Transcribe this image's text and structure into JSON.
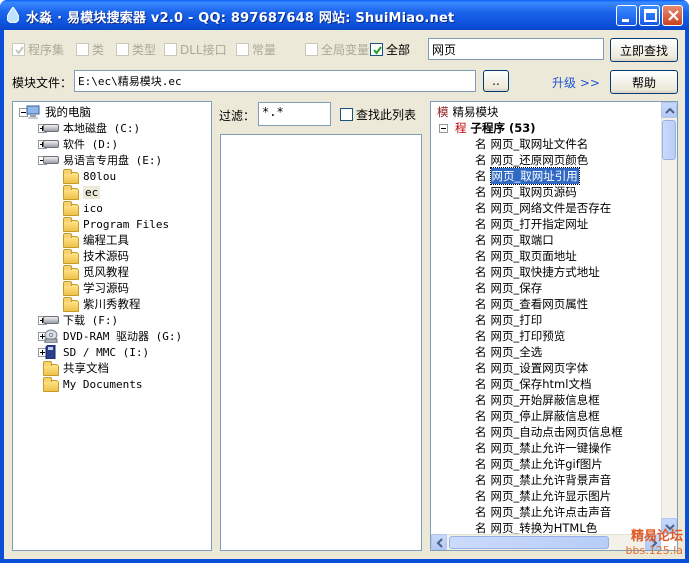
{
  "window": {
    "title": "水淼 · 易模块搜索器 v2.0 - QQ: 897687648 网站: ShuiMiao.net"
  },
  "filters": {
    "checkboxes": [
      {
        "label": "程序集",
        "checked": true,
        "enabled": false
      },
      {
        "label": "类",
        "checked": false,
        "enabled": false
      },
      {
        "label": "类型",
        "checked": false,
        "enabled": false
      },
      {
        "label": "DLL接口",
        "checked": false,
        "enabled": false
      },
      {
        "label": "常量",
        "checked": false,
        "enabled": false
      },
      {
        "label": "全局变量",
        "checked": false,
        "enabled": false
      },
      {
        "label": "全部",
        "checked": true,
        "enabled": true
      }
    ],
    "search_value": "网页",
    "search_button": "立即查找"
  },
  "module_row": {
    "label": "模块文件：",
    "path": "E:\\ec\\精易模块.ec",
    "browse_label": "..",
    "upgrade_label": "升级 >>",
    "help_label": "帮助"
  },
  "tree": [
    {
      "label": "我的电脑",
      "icon": "computer-icon",
      "level": 0,
      "expander": "minus"
    },
    {
      "label": "本地磁盘 (C:)",
      "icon": "drive-icon",
      "level": 1,
      "expander": "plus"
    },
    {
      "label": "软件 (D:)",
      "icon": "drive-icon",
      "level": 1,
      "expander": "plus"
    },
    {
      "label": "易语言专用盘 (E:)",
      "icon": "drive-icon",
      "level": 1,
      "expander": "minus"
    },
    {
      "label": "80lou",
      "icon": "folder-icon",
      "level": 2,
      "expander": ""
    },
    {
      "label": "ec",
      "icon": "folder-icon",
      "level": 2,
      "expander": "",
      "selected": true
    },
    {
      "label": "ico",
      "icon": "folder-icon",
      "level": 2,
      "expander": ""
    },
    {
      "label": "Program Files",
      "icon": "folder-icon",
      "level": 2,
      "expander": "plus"
    },
    {
      "label": "编程工具",
      "icon": "folder-icon",
      "level": 2,
      "expander": "plus"
    },
    {
      "label": "技术源码",
      "icon": "folder-icon",
      "level": 2,
      "expander": ""
    },
    {
      "label": "觅风教程",
      "icon": "folder-icon",
      "level": 2,
      "expander": "plus"
    },
    {
      "label": "学习源码",
      "icon": "folder-icon",
      "level": 2,
      "expander": ""
    },
    {
      "label": "紫川秀教程",
      "icon": "folder-icon",
      "level": 2,
      "expander": ""
    },
    {
      "label": "下载 (F:)",
      "icon": "drive-icon",
      "level": 1,
      "expander": "plus"
    },
    {
      "label": "DVD-RAM 驱动器 (G:)",
      "icon": "dvd-icon",
      "level": 1,
      "expander": "plus"
    },
    {
      "label": "SD / MMC (I:)",
      "icon": "sd-icon",
      "level": 1,
      "expander": "plus"
    },
    {
      "label": "共享文档",
      "icon": "folder-icon",
      "level": 1,
      "expander": ""
    },
    {
      "label": "My Documents",
      "icon": "folder-icon",
      "level": 1,
      "expander": ""
    }
  ],
  "filter": {
    "label": "过滤：",
    "value": "*.*",
    "checkbox_label": "查找此列表"
  },
  "results": {
    "root_tag": "模",
    "root_label": "精易模块",
    "group_tag": "程",
    "group_label": "子程序 (53)",
    "item_tag": "名",
    "items": [
      "网页_取网址文件名",
      "网页_还原网页颜色",
      "网页_取网址引用",
      "网页_取网页源码",
      "网页_网络文件是否存在",
      "网页_打开指定网址",
      "网页_取端口",
      "网页_取页面地址",
      "网页_取快捷方式地址",
      "网页_保存",
      "网页_查看网页属性",
      "网页_打印",
      "网页_打印预览",
      "网页_全选",
      "网页_设置网页字体",
      "网页_保存html文档",
      "网页_开始屏蔽信息框",
      "网页_停止屏蔽信息框",
      "网页_自动点击网页信息框",
      "网页_禁止允许一键操作",
      "网页_禁止允许gif图片",
      "网页_禁止允许背景声音",
      "网页_禁止允许显示图片",
      "网页_禁止允许点击声音",
      "网页_转换为HTML色"
    ],
    "selected_index": 2
  },
  "watermark": {
    "line1": "精易论坛",
    "line2": "bbs.125.la"
  }
}
